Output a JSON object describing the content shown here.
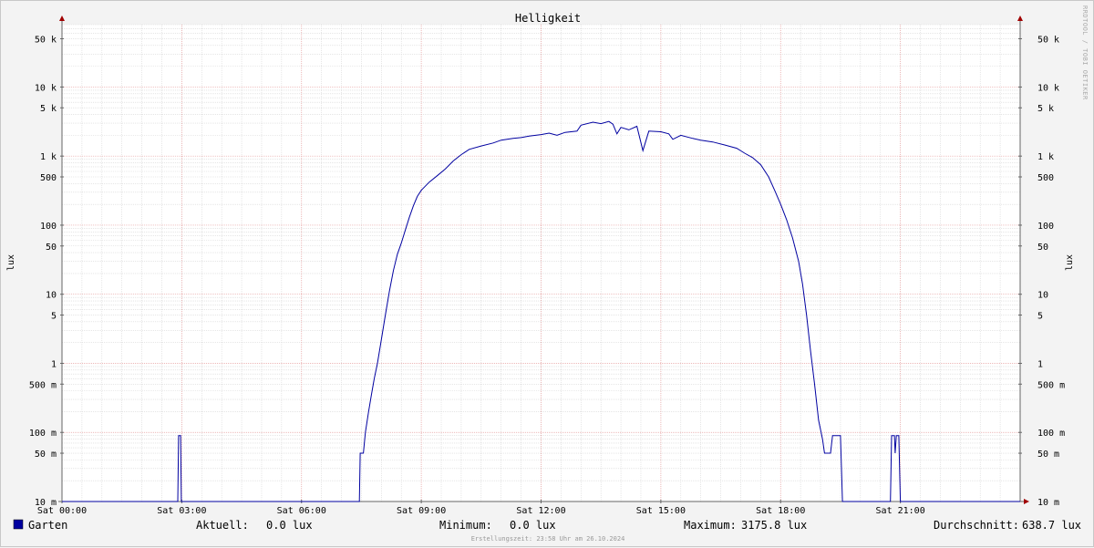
{
  "chart_data": {
    "type": "line",
    "title": "Helligkeit",
    "ylabel": "lux",
    "watermark": "RRDTOOL / TOBI OETIKER",
    "y_scale": "log",
    "ylim": [
      0.01,
      80000
    ],
    "xlim_hours": [
      0,
      24
    ],
    "grid": true,
    "x_ticks": [
      {
        "hour": 0,
        "label": "Sat 00:00"
      },
      {
        "hour": 3,
        "label": "Sat 03:00"
      },
      {
        "hour": 6,
        "label": "Sat 06:00"
      },
      {
        "hour": 9,
        "label": "Sat 09:00"
      },
      {
        "hour": 12,
        "label": "Sat 12:00"
      },
      {
        "hour": 15,
        "label": "Sat 15:00"
      },
      {
        "hour": 18,
        "label": "Sat 18:00"
      },
      {
        "hour": 21,
        "label": "Sat 21:00"
      }
    ],
    "y_ticks": [
      {
        "value": 0.01,
        "label": "10 m"
      },
      {
        "value": 0.05,
        "label": "50 m"
      },
      {
        "value": 0.1,
        "label": "100 m"
      },
      {
        "value": 0.5,
        "label": "500 m"
      },
      {
        "value": 1,
        "label": "1"
      },
      {
        "value": 5,
        "label": "5"
      },
      {
        "value": 10,
        "label": "10"
      },
      {
        "value": 50,
        "label": "50"
      },
      {
        "value": 100,
        "label": "100"
      },
      {
        "value": 500,
        "label": "500"
      },
      {
        "value": 1000,
        "label": "1 k"
      },
      {
        "value": 5000,
        "label": "5 k"
      },
      {
        "value": 10000,
        "label": "10 k"
      },
      {
        "value": 50000,
        "label": "50 k"
      }
    ],
    "series": [
      {
        "name": "Garten",
        "color": "#0000a0",
        "points": [
          [
            0,
            0.01
          ],
          [
            2.9,
            0.01
          ],
          [
            2.92,
            0.09
          ],
          [
            2.97,
            0.09
          ],
          [
            2.99,
            0.01
          ],
          [
            7.45,
            0.01
          ],
          [
            7.47,
            0.05
          ],
          [
            7.55,
            0.05
          ],
          [
            7.6,
            0.1
          ],
          [
            7.68,
            0.2
          ],
          [
            7.75,
            0.35
          ],
          [
            7.82,
            0.6
          ],
          [
            7.9,
            1
          ],
          [
            8.0,
            2.2
          ],
          [
            8.1,
            5
          ],
          [
            8.2,
            11
          ],
          [
            8.3,
            22
          ],
          [
            8.4,
            38
          ],
          [
            8.5,
            55
          ],
          [
            8.6,
            85
          ],
          [
            8.7,
            130
          ],
          [
            8.8,
            190
          ],
          [
            8.9,
            260
          ],
          [
            9.0,
            320
          ],
          [
            9.2,
            420
          ],
          [
            9.4,
            520
          ],
          [
            9.6,
            650
          ],
          [
            9.8,
            850
          ],
          [
            10.0,
            1050
          ],
          [
            10.2,
            1250
          ],
          [
            10.5,
            1400
          ],
          [
            10.8,
            1550
          ],
          [
            11.0,
            1700
          ],
          [
            11.3,
            1800
          ],
          [
            11.5,
            1850
          ],
          [
            11.7,
            1950
          ],
          [
            12.0,
            2050
          ],
          [
            12.2,
            2150
          ],
          [
            12.4,
            2000
          ],
          [
            12.6,
            2200
          ],
          [
            12.9,
            2300
          ],
          [
            13.0,
            2800
          ],
          [
            13.3,
            3100
          ],
          [
            13.5,
            2950
          ],
          [
            13.7,
            3175.8
          ],
          [
            13.8,
            2900
          ],
          [
            13.9,
            2100
          ],
          [
            14.0,
            2600
          ],
          [
            14.2,
            2400
          ],
          [
            14.4,
            2700
          ],
          [
            14.55,
            1200
          ],
          [
            14.7,
            2300
          ],
          [
            15.0,
            2250
          ],
          [
            15.2,
            2100
          ],
          [
            15.3,
            1750
          ],
          [
            15.5,
            2000
          ],
          [
            15.8,
            1800
          ],
          [
            16.0,
            1700
          ],
          [
            16.3,
            1600
          ],
          [
            16.6,
            1450
          ],
          [
            16.9,
            1300
          ],
          [
            17.1,
            1100
          ],
          [
            17.3,
            950
          ],
          [
            17.5,
            750
          ],
          [
            17.7,
            500
          ],
          [
            17.85,
            320
          ],
          [
            18.0,
            200
          ],
          [
            18.15,
            120
          ],
          [
            18.3,
            65
          ],
          [
            18.45,
            30
          ],
          [
            18.55,
            14
          ],
          [
            18.65,
            5
          ],
          [
            18.75,
            1.5
          ],
          [
            18.85,
            0.5
          ],
          [
            18.95,
            0.15
          ],
          [
            19.05,
            0.08
          ],
          [
            19.1,
            0.05
          ],
          [
            19.25,
            0.05
          ],
          [
            19.3,
            0.09
          ],
          [
            19.5,
            0.09
          ],
          [
            19.55,
            0.01
          ],
          [
            20.75,
            0.01
          ],
          [
            20.78,
            0.09
          ],
          [
            20.85,
            0.09
          ],
          [
            20.87,
            0.05
          ],
          [
            20.9,
            0.09
          ],
          [
            20.96,
            0.09
          ],
          [
            21.0,
            0.01
          ],
          [
            24.0,
            0.01
          ]
        ]
      }
    ]
  },
  "legend": {
    "series_name": "Garten",
    "current_label": "Aktuell:",
    "current_value": "0.0 lux",
    "minimum_label": "Minimum:",
    "minimum_value": "0.0 lux",
    "maximum_label": "Maximum:",
    "maximum_value": "3175.8 lux",
    "average_label": "Durchschnitt:",
    "average_value": "638.7 lux"
  },
  "footer": "Erstellungszeit: 23:58 Uhr am 26.10.2024",
  "colors": {
    "major_grid": "#e8a0a0",
    "minor_grid": "#d6d6d6",
    "axis": "#666666",
    "arrow": "#a00000",
    "line": "#0000a0"
  }
}
